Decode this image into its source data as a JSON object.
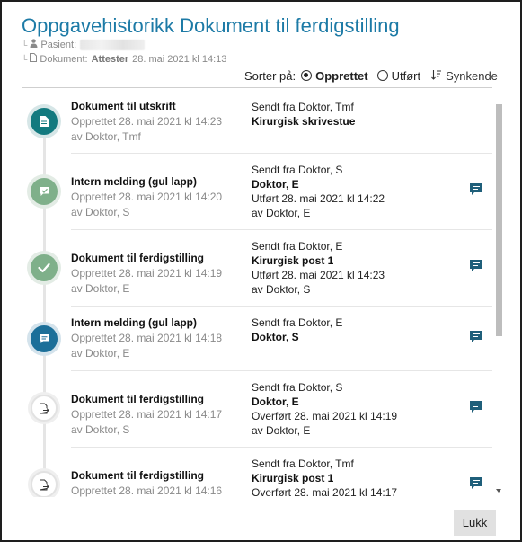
{
  "dialog": {
    "title": "Oppgavehistorikk Dokument til ferdigstilling",
    "patient_label": "Pasient:",
    "document_label": "Dokument:",
    "document_type": "Attester",
    "document_date": "28. mai 2021 kl 14:13"
  },
  "sort": {
    "label": "Sorter på:",
    "options": [
      "Opprettet",
      "Utført"
    ],
    "selected": "Opprettet",
    "sync_label": "Synkende"
  },
  "entries": [
    {
      "title": "Dokument til utskrift",
      "created": "Opprettet 28. mai 2021 kl 14:23",
      "by": "av Doktor, Tmf",
      "sent": "Sendt fra Doktor, Tmf",
      "recipient": "Kirurgisk skrivestue",
      "extra": "",
      "extra_by": "",
      "icon": "document-icon",
      "status": "teal",
      "has_message": false
    },
    {
      "title": "Intern melding (gul lapp)",
      "created": "Opprettet 28. mai 2021 kl 14:20",
      "by": "av Doktor, S",
      "sent": "Sendt fra Doktor, S",
      "recipient": "Doktor, E",
      "extra": "Utført 28. mai 2021 kl 14:22",
      "extra_by": "av Doktor, E",
      "icon": "message-check-icon",
      "status": "green",
      "has_message": true
    },
    {
      "title": "Dokument til ferdigstilling",
      "created": "Opprettet 28. mai 2021 kl 14:19",
      "by": "av Doktor, E",
      "sent": "Sendt fra Doktor, E",
      "recipient": "Kirurgisk post 1",
      "extra": "Utført 28. mai 2021 kl 14:23",
      "extra_by": "av Doktor, S",
      "icon": "check-icon",
      "status": "green",
      "has_message": true
    },
    {
      "title": "Intern melding (gul lapp)",
      "created": "Opprettet 28. mai 2021 kl 14:18",
      "by": "av Doktor, E",
      "sent": "Sendt fra Doktor, E",
      "recipient": "Doktor, S",
      "extra": "",
      "extra_by": "",
      "icon": "message-icon",
      "status": "blue",
      "has_message": true
    },
    {
      "title": "Dokument til ferdigstilling",
      "created": "Opprettet 28. mai 2021 kl 14:17",
      "by": "av Doktor, S",
      "sent": "Sendt fra Doktor, S",
      "recipient": "Doktor, E",
      "extra": "Overført 28. mai 2021 kl 14:19",
      "extra_by": "av Doktor, E",
      "icon": "document-forward-icon",
      "status": "white",
      "has_message": true
    },
    {
      "title": "Dokument til ferdigstilling",
      "created": "Opprettet 28. mai 2021 kl 14:16",
      "by": "",
      "sent": "Sendt fra Doktor, Tmf",
      "recipient": "Kirurgisk post 1",
      "extra": "Overført 28. mai 2021 kl 14:17",
      "extra_by": "",
      "icon": "document-forward-icon",
      "status": "white",
      "has_message": true
    }
  ],
  "buttons": {
    "close": "Lukk"
  },
  "colors": {
    "title": "#1c7aa6",
    "teal": "#137a7f",
    "green": "#7fb08a",
    "blue": "#1c6f99",
    "message_icon": "#1f5f7a"
  }
}
